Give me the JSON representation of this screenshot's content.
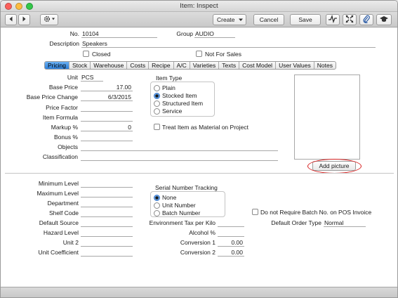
{
  "window": {
    "title": "Item: Inspect"
  },
  "toolbar": {
    "create_label": "Create",
    "cancel_label": "Cancel",
    "save_label": "Save"
  },
  "header": {
    "no_label": "No.",
    "no_value": "10104",
    "group_label": "Group",
    "group_value": "AUDIO",
    "description_label": "Description",
    "description_value": "Speakers",
    "closed_label": "Closed",
    "not_for_sales_label": "Not For Sales"
  },
  "tabs": [
    {
      "label": "Pricing",
      "active": true
    },
    {
      "label": "Stock"
    },
    {
      "label": "Warehouse"
    },
    {
      "label": "Costs"
    },
    {
      "label": "Recipe"
    },
    {
      "label": "A/C"
    },
    {
      "label": "Varieties"
    },
    {
      "label": "Texts"
    },
    {
      "label": "Cost Model"
    },
    {
      "label": "User Values"
    },
    {
      "label": "Notes"
    }
  ],
  "pricing": {
    "unit_label": "Unit",
    "unit_value": "PCS",
    "base_price_label": "Base Price",
    "base_price_value": "17.00",
    "base_price_change_label": "Base Price Change",
    "base_price_change_value": "6/3/2015",
    "price_factor_label": "Price Factor",
    "price_factor_value": "",
    "item_formula_label": "Item Formula",
    "item_formula_value": "",
    "markup_label": "Markup %",
    "markup_value": "0",
    "bonus_label": "Bonus %",
    "bonus_value": "",
    "objects_label": "Objects",
    "objects_value": "",
    "classification_label": "Classification",
    "classification_value": "",
    "item_type_title": "Item Type",
    "item_types": [
      {
        "label": "Plain",
        "selected": false
      },
      {
        "label": "Stocked Item",
        "selected": true
      },
      {
        "label": "Structured Item",
        "selected": false
      },
      {
        "label": "Service",
        "selected": false
      }
    ],
    "treat_as_material_label": "Treat Item as Material on Project",
    "add_picture_label": "Add picture"
  },
  "stock": {
    "minimum_level_label": "Minimum Level",
    "maximum_level_label": "Maximum Level",
    "department_label": "Department",
    "shelf_code_label": "Shelf Code",
    "default_source_label": "Default Source",
    "hazard_level_label": "Hazard Level",
    "unit2_label": "Unit 2",
    "unit_coefficient_label": "Unit Coefficient",
    "serial_title": "Serial Number Tracking",
    "serial_options": [
      {
        "label": "None",
        "selected": true
      },
      {
        "label": "Unit Number",
        "selected": false
      },
      {
        "label": "Batch Number",
        "selected": false
      }
    ],
    "env_tax_label": "Environment Tax per Kilo",
    "alcohol_label": "Alcohol %",
    "conversion1_label": "Conversion 1",
    "conversion1_value": "0.00",
    "conversion2_label": "Conversion 2",
    "conversion2_value": "0.00",
    "no_batch_pos_label": "Do not Require Batch No. on POS Invoice",
    "default_order_type_label": "Default Order Type",
    "default_order_type_value": "Normal"
  },
  "colors": {
    "accent": "#2d7fd9",
    "highlight_ring": "#d81e1e"
  }
}
